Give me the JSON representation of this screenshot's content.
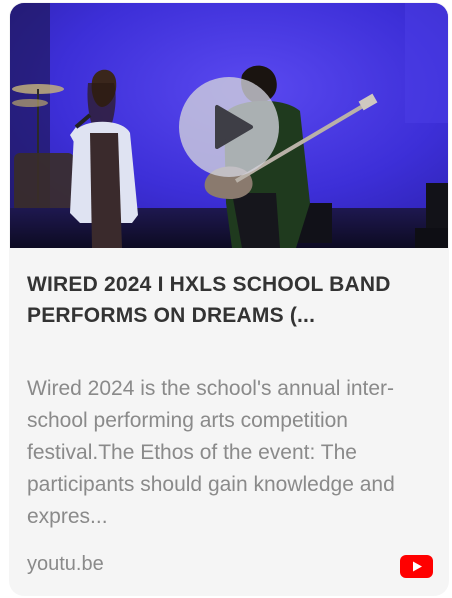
{
  "card": {
    "title": "WIRED 2024 I HXLS SCHOOL BAND PERFORMS ON DREAMS (...",
    "description": "Wired 2024 is the school's annual inter-school performing arts competition festival.The Ethos of the event: The participants should gain knowledge and expres...",
    "domain": "youtu.be",
    "thumbnail": {
      "alt": "Student performers on a stage lit in blue: a singer with a microphone and a bass guitarist",
      "play_icon": "play-icon",
      "background_color": "#3b2fd6"
    },
    "source_icon": "youtube-icon",
    "source_icon_color": "#ff0000",
    "colors": {
      "title": "#333333",
      "description": "#8a8a8a",
      "card_background": "#f5f5f5"
    }
  }
}
